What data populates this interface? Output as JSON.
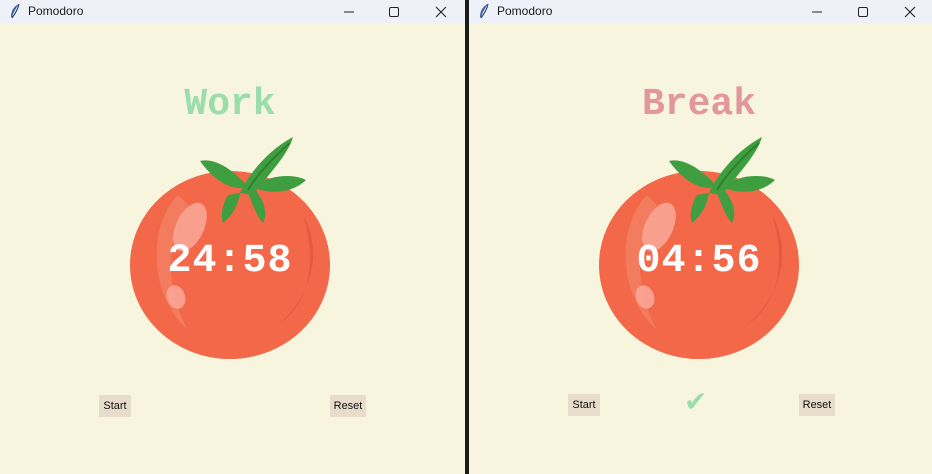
{
  "windows": [
    {
      "title": "Pomodoro",
      "mode_label": "Work",
      "mode_color": "#9bdeac",
      "timer": "24:58",
      "start_label": "Start",
      "reset_label": "Reset",
      "checkmarks": ""
    },
    {
      "title": "Pomodoro",
      "mode_label": "Break",
      "mode_color": "#e2979c",
      "timer": "04:56",
      "start_label": "Start",
      "reset_label": "Reset",
      "checkmarks": "✔"
    }
  ],
  "colors": {
    "background": "#f7f5de",
    "tomato": "#f26849",
    "leaf": "#3f9e3f",
    "button": "#e8dccb"
  },
  "icons": {
    "app": "feather-icon",
    "minimize": "minimize-icon",
    "maximize": "maximize-icon",
    "close": "close-icon",
    "tomato": "tomato-image"
  }
}
